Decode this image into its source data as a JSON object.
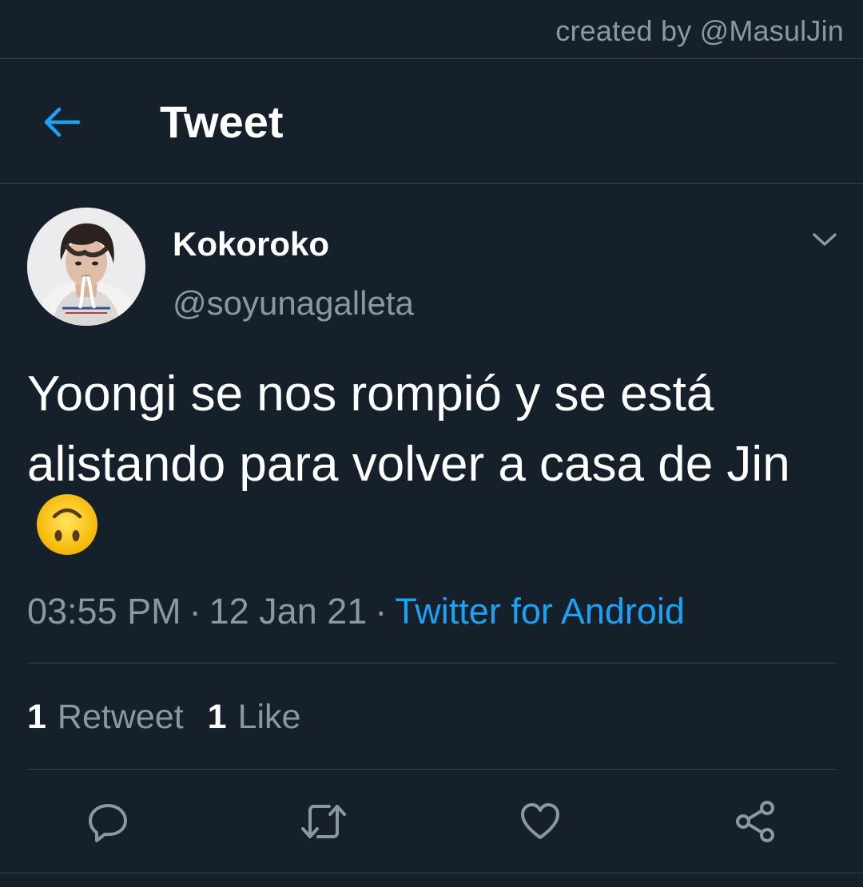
{
  "watermark": "created by @MasulJin",
  "header": {
    "title": "Tweet",
    "back_icon": "arrow-left-icon"
  },
  "tweet": {
    "display_name": "Kokoroko",
    "handle": "@soyunagalleta",
    "text": "Yoongi se nos rompió y se está alistando para volver a casa de Jin",
    "emoji": "upside-down-face-emoji",
    "time": "03:55 PM",
    "date": "12 Jan 21",
    "separator": "·",
    "source": "Twitter for Android"
  },
  "stats": {
    "retweets_count": "1",
    "retweets_label": "Retweet",
    "likes_count": "1",
    "likes_label": "Like"
  },
  "actions": [
    {
      "name": "reply",
      "icon": "reply-icon"
    },
    {
      "name": "retweet",
      "icon": "retweet-icon"
    },
    {
      "name": "like",
      "icon": "heart-icon"
    },
    {
      "name": "share",
      "icon": "share-icon"
    }
  ],
  "colors": {
    "background": "#15202b",
    "accent": "#1da1f2",
    "secondary_text": "#8899a6",
    "divider": "#38444d"
  }
}
